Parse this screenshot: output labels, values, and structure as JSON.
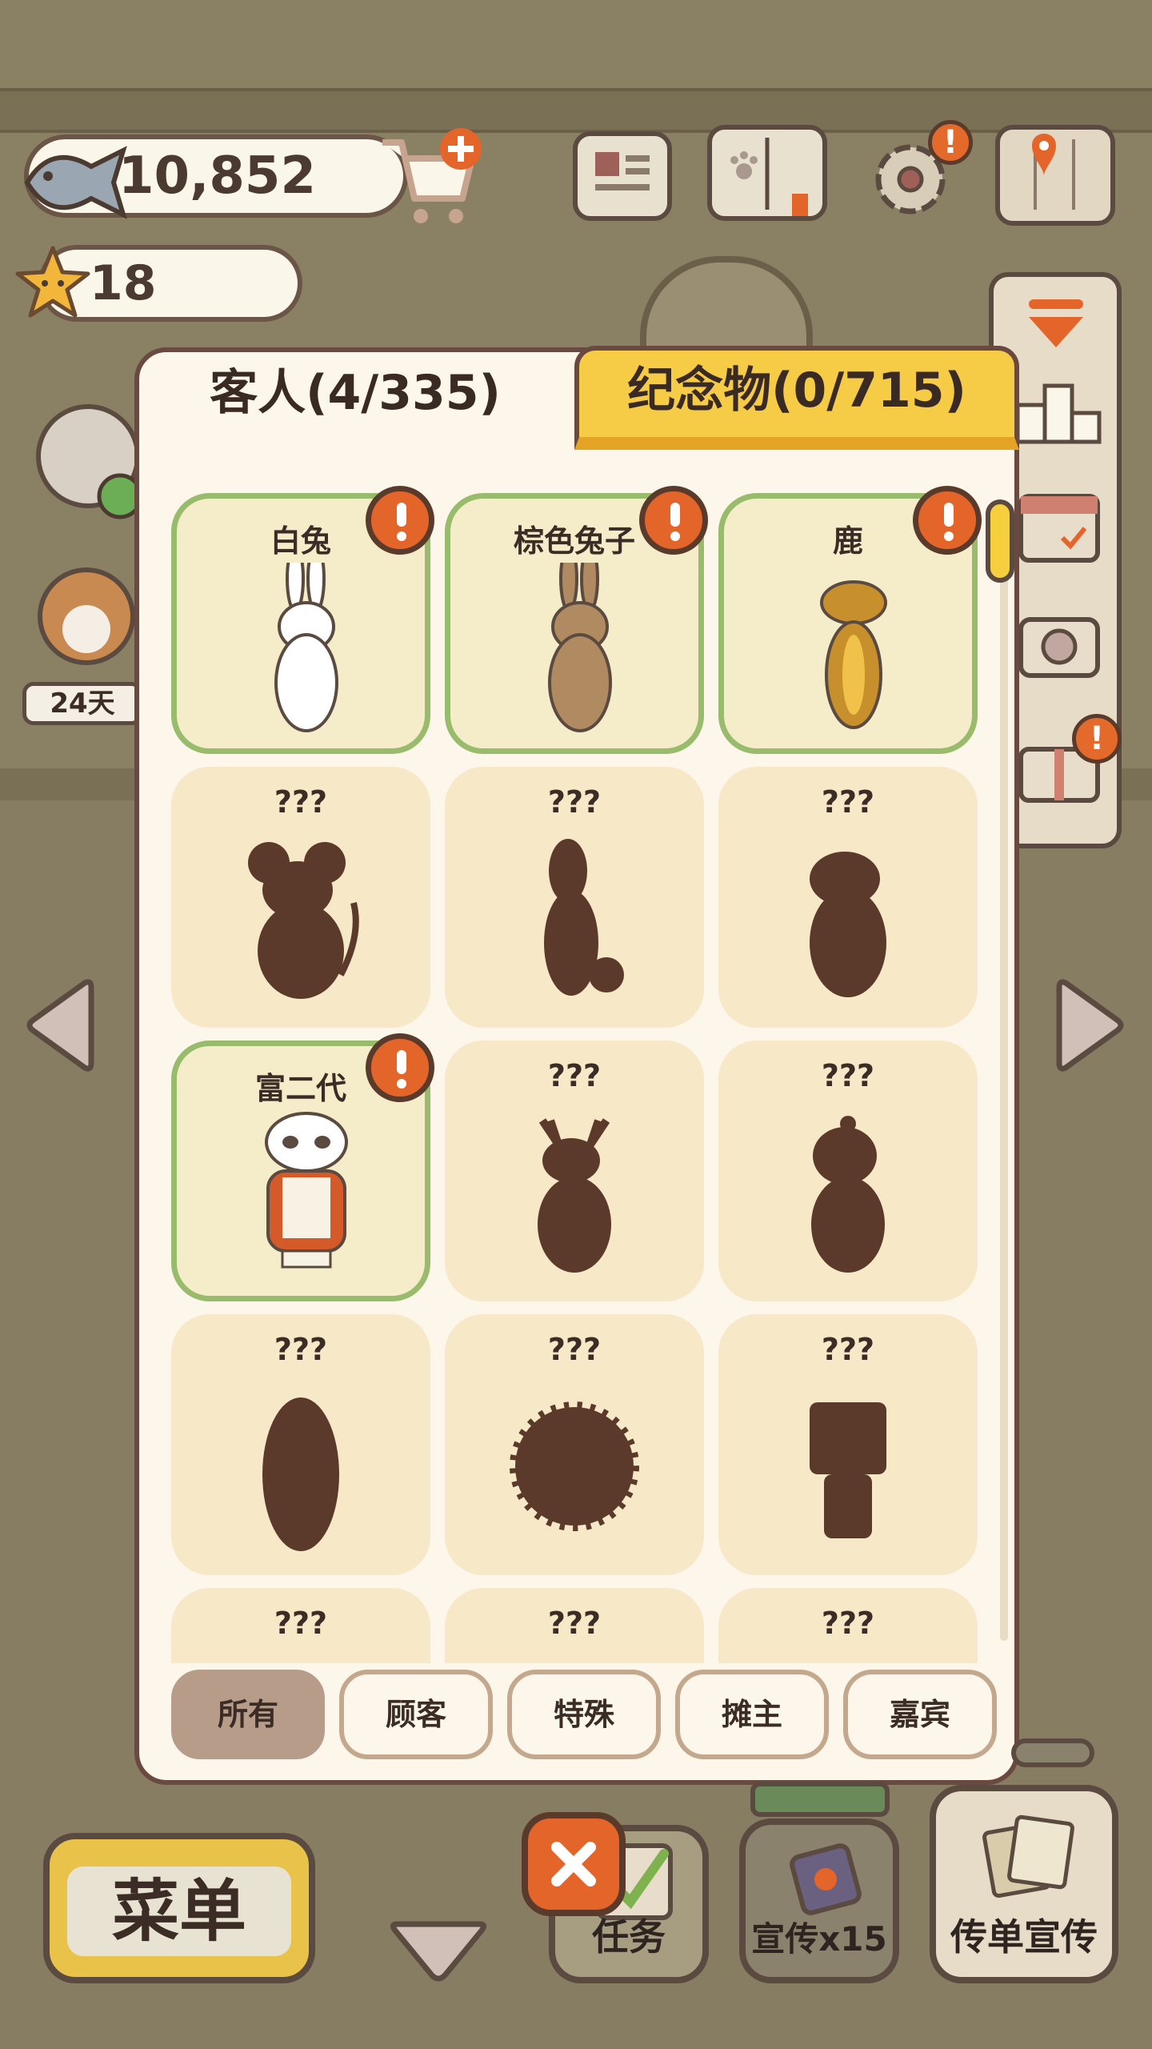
{
  "resources": {
    "fish_count": "10,852",
    "star_count": "18"
  },
  "left_side": {
    "days_label": "24天"
  },
  "panel": {
    "tabs": [
      {
        "label": "客人(4/335)",
        "active": true
      },
      {
        "label": "纪念物(0/715)",
        "active": false
      }
    ],
    "cards": [
      {
        "name": "白兔",
        "unlocked": true,
        "new": true,
        "icon": "white-rabbit-icon"
      },
      {
        "name": "棕色兔子",
        "unlocked": true,
        "new": true,
        "icon": "brown-rabbit-icon"
      },
      {
        "name": "鹿",
        "unlocked": true,
        "new": true,
        "icon": "deer-icon"
      },
      {
        "name": "???",
        "unlocked": false,
        "icon": "mouse-silhouette-icon"
      },
      {
        "name": "???",
        "unlocked": false,
        "icon": "squirrel-silhouette-icon"
      },
      {
        "name": "???",
        "unlocked": false,
        "icon": "bear-silhouette-icon"
      },
      {
        "name": "富二代",
        "unlocked": true,
        "new": true,
        "icon": "panda-icon"
      },
      {
        "name": "???",
        "unlocked": false,
        "icon": "moose-silhouette-icon"
      },
      {
        "name": "???",
        "unlocked": false,
        "icon": "otter-silhouette-icon"
      },
      {
        "name": "???",
        "unlocked": false,
        "icon": "seal-silhouette-icon"
      },
      {
        "name": "???",
        "unlocked": false,
        "icon": "hedgehog-silhouette-icon"
      },
      {
        "name": "???",
        "unlocked": false,
        "icon": "tv-head-silhouette-icon"
      },
      {
        "name": "???",
        "unlocked": false,
        "icon": "unknown-silhouette-icon"
      },
      {
        "name": "???",
        "unlocked": false,
        "icon": "unknown-silhouette-icon"
      },
      {
        "name": "???",
        "unlocked": false,
        "icon": "unknown-silhouette-icon"
      }
    ],
    "filters": [
      {
        "label": "所有",
        "active": true
      },
      {
        "label": "顾客",
        "active": false
      },
      {
        "label": "特殊",
        "active": false
      },
      {
        "label": "摊主",
        "active": false
      },
      {
        "label": "嘉宾",
        "active": false
      }
    ]
  },
  "bottom_bar": {
    "menu_label": "菜单",
    "task_label": "任务",
    "promo_label": "宣传x15",
    "flyer_label": "传单宣传"
  },
  "colors": {
    "accent_yellow": "#f6cb46",
    "badge_orange": "#e4652a",
    "unlocked_border": "#98bb6c",
    "card_bg": "#f7e9c8",
    "silhouette": "#5b3a2c"
  }
}
